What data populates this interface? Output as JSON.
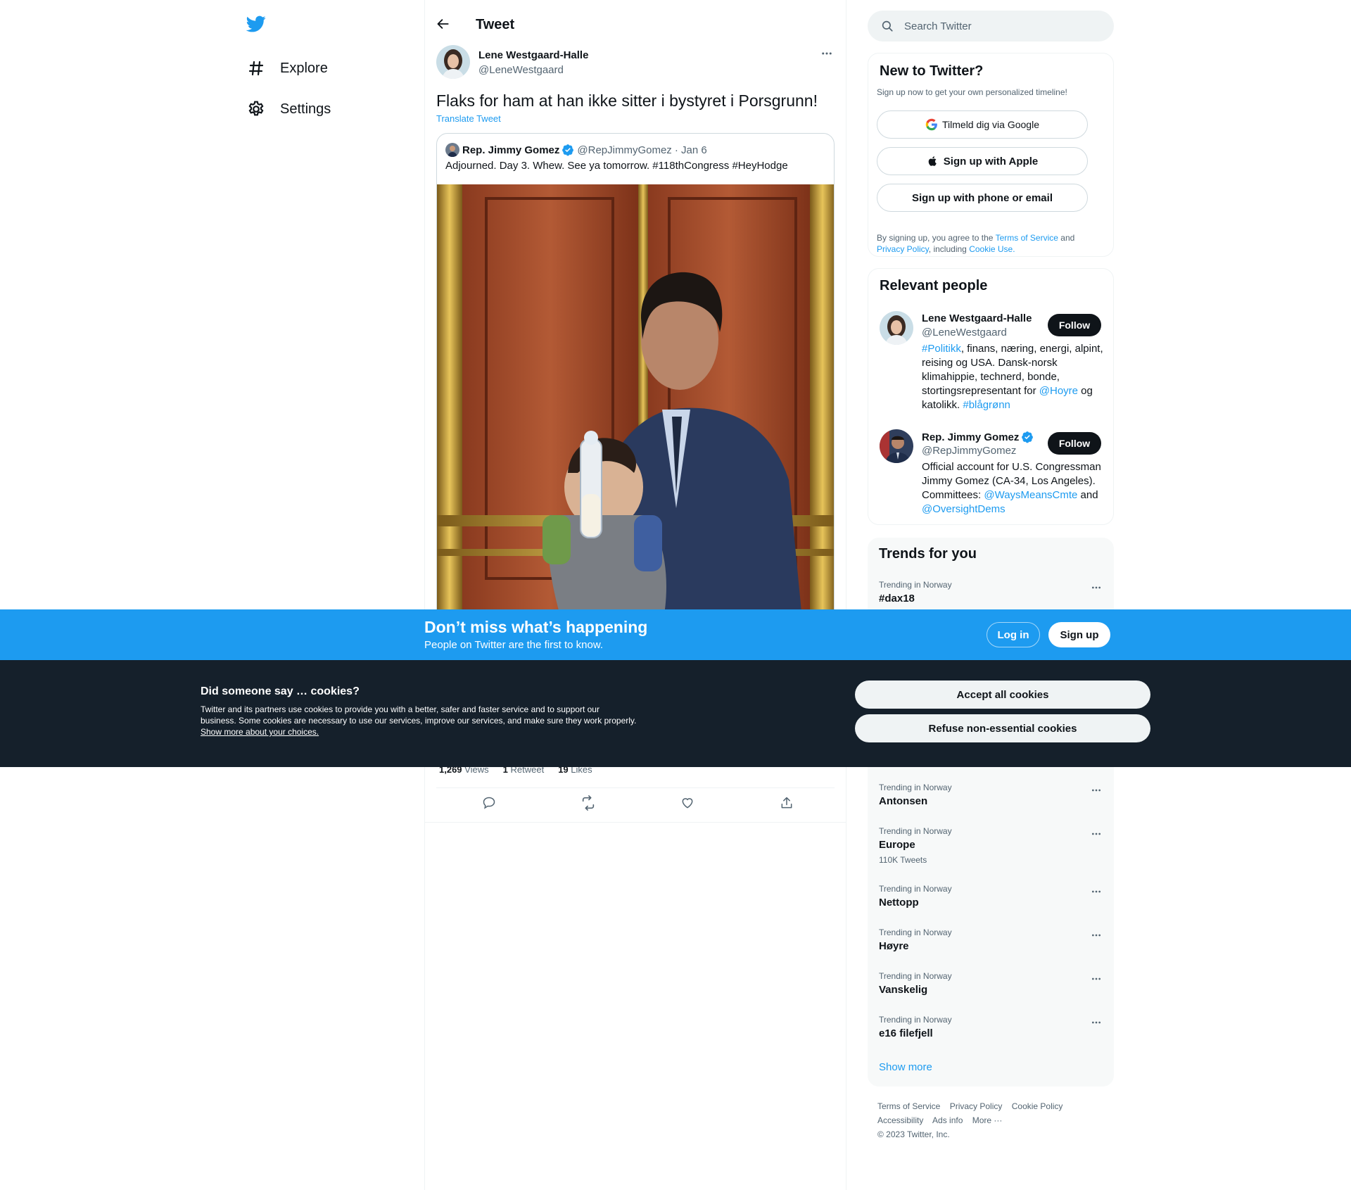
{
  "nav": {
    "explore": "Explore",
    "settings": "Settings"
  },
  "header": {
    "title": "Tweet"
  },
  "tweet": {
    "author_name": "Lene Westgaard-Halle",
    "author_handle": "@LeneWestgaard",
    "text": "Flaks for ham at han ikke sitter i bystyret i Porsgrunn!",
    "translate": "Translate Tweet",
    "quote": {
      "author_name": "Rep. Jimmy Gomez",
      "author_handle": "@RepJimmyGomez",
      "date": "· Jan 6",
      "text": "Adjourned. Day 3. Whew. See ya tomorrow. #118thCongress #HeyHodge"
    },
    "stats": {
      "views_count": "1,269",
      "views_label": "Views",
      "retweets_count": "1",
      "retweets_label": "Retweet",
      "likes_count": "19",
      "likes_label": "Likes"
    }
  },
  "search": {
    "placeholder": "Search Twitter"
  },
  "signup_card": {
    "title": "New to Twitter?",
    "subtitle": "Sign up now to get your own personalized timeline!",
    "google": "Tilmeld dig via Google",
    "apple": "Sign up with Apple",
    "phone": "Sign up with phone or email",
    "legal_prefix": "By signing up, you agree to the",
    "terms": "Terms of Service",
    "and": "and",
    "privacy": "Privacy Policy",
    "including": ", including",
    "cookie_use": "Cookie Use."
  },
  "relevant": {
    "title": "Relevant people",
    "follow_label": "Follow",
    "people": [
      {
        "name": "Lene Westgaard-Halle",
        "handle": "@LeneWestgaard",
        "bio_tag1": "#Politikk",
        "bio_text1": ", finans, næring, energi, alpint, reising og USA. Dansk-norsk klimahippie, technerd, bonde, stortingsrepresentant for ",
        "bio_mention": "@Hoyre",
        "bio_text2": " og katolikk. ",
        "bio_tag2": "#blågrønn"
      },
      {
        "name": "Rep. Jimmy Gomez",
        "handle": "@RepJimmyGomez",
        "bio_text1": "Official account for U.S. Congressman Jimmy Gomez (CA-34, Los Angeles). Committees: ",
        "bio_mention1": "@WaysMeansCmte",
        "bio_text2": " and ",
        "bio_mention2": "@OversightDems"
      }
    ]
  },
  "trends": {
    "title": "Trends for you",
    "items": [
      {
        "meta": "Trending in Norway",
        "name": "#dax18",
        "count": ""
      },
      {
        "meta": "Trending in Norway",
        "name": "Antonsen",
        "count": ""
      },
      {
        "meta": "Trending in Norway",
        "name": "Europe",
        "count": "110K Tweets"
      },
      {
        "meta": "Trending in Norway",
        "name": "Nettopp",
        "count": ""
      },
      {
        "meta": "Trending in Norway",
        "name": "Høyre",
        "count": ""
      },
      {
        "meta": "Trending in Norway",
        "name": "Vanskelig",
        "count": ""
      },
      {
        "meta": "Trending in Norway",
        "name": "e16 filefjell",
        "count": ""
      }
    ],
    "show_more": "Show more"
  },
  "footer": {
    "terms": "Terms of Service",
    "privacy": "Privacy Policy",
    "cookie": "Cookie Policy",
    "accessibility": "Accessibility",
    "ads": "Ads info",
    "more": "More ···",
    "copyright": "© 2023 Twitter, Inc."
  },
  "signup_bar": {
    "title": "Don’t miss what’s happening",
    "subtitle": "People on Twitter are the first to know.",
    "login": "Log in",
    "signup": "Sign up"
  },
  "cookies": {
    "title": "Did someone say … cookies?",
    "text": "Twitter and its partners use cookies to provide you with a better, safer and faster service and to support our business. Some cookies are necessary to use our services, improve our services, and make sure they work properly. ",
    "link": "Show more about your choices.",
    "accept": "Accept all cookies",
    "refuse": "Refuse non-essential cookies"
  },
  "colors": {
    "brand_blue": "#1d9bf0",
    "text_dark": "#0f1419",
    "text_gray": "#536471",
    "cookie_bg": "#15202b"
  },
  "icons": {
    "logo": "twitter-bird-icon",
    "explore": "hashtag-icon",
    "settings": "gear-icon",
    "back": "arrow-left-icon",
    "more": "more-dots-icon",
    "verified": "verified-badge-icon",
    "reply": "reply-icon",
    "retweet": "retweet-icon",
    "like": "heart-icon",
    "share": "share-icon",
    "search": "search-icon",
    "google": "google-icon",
    "apple": "apple-icon"
  }
}
